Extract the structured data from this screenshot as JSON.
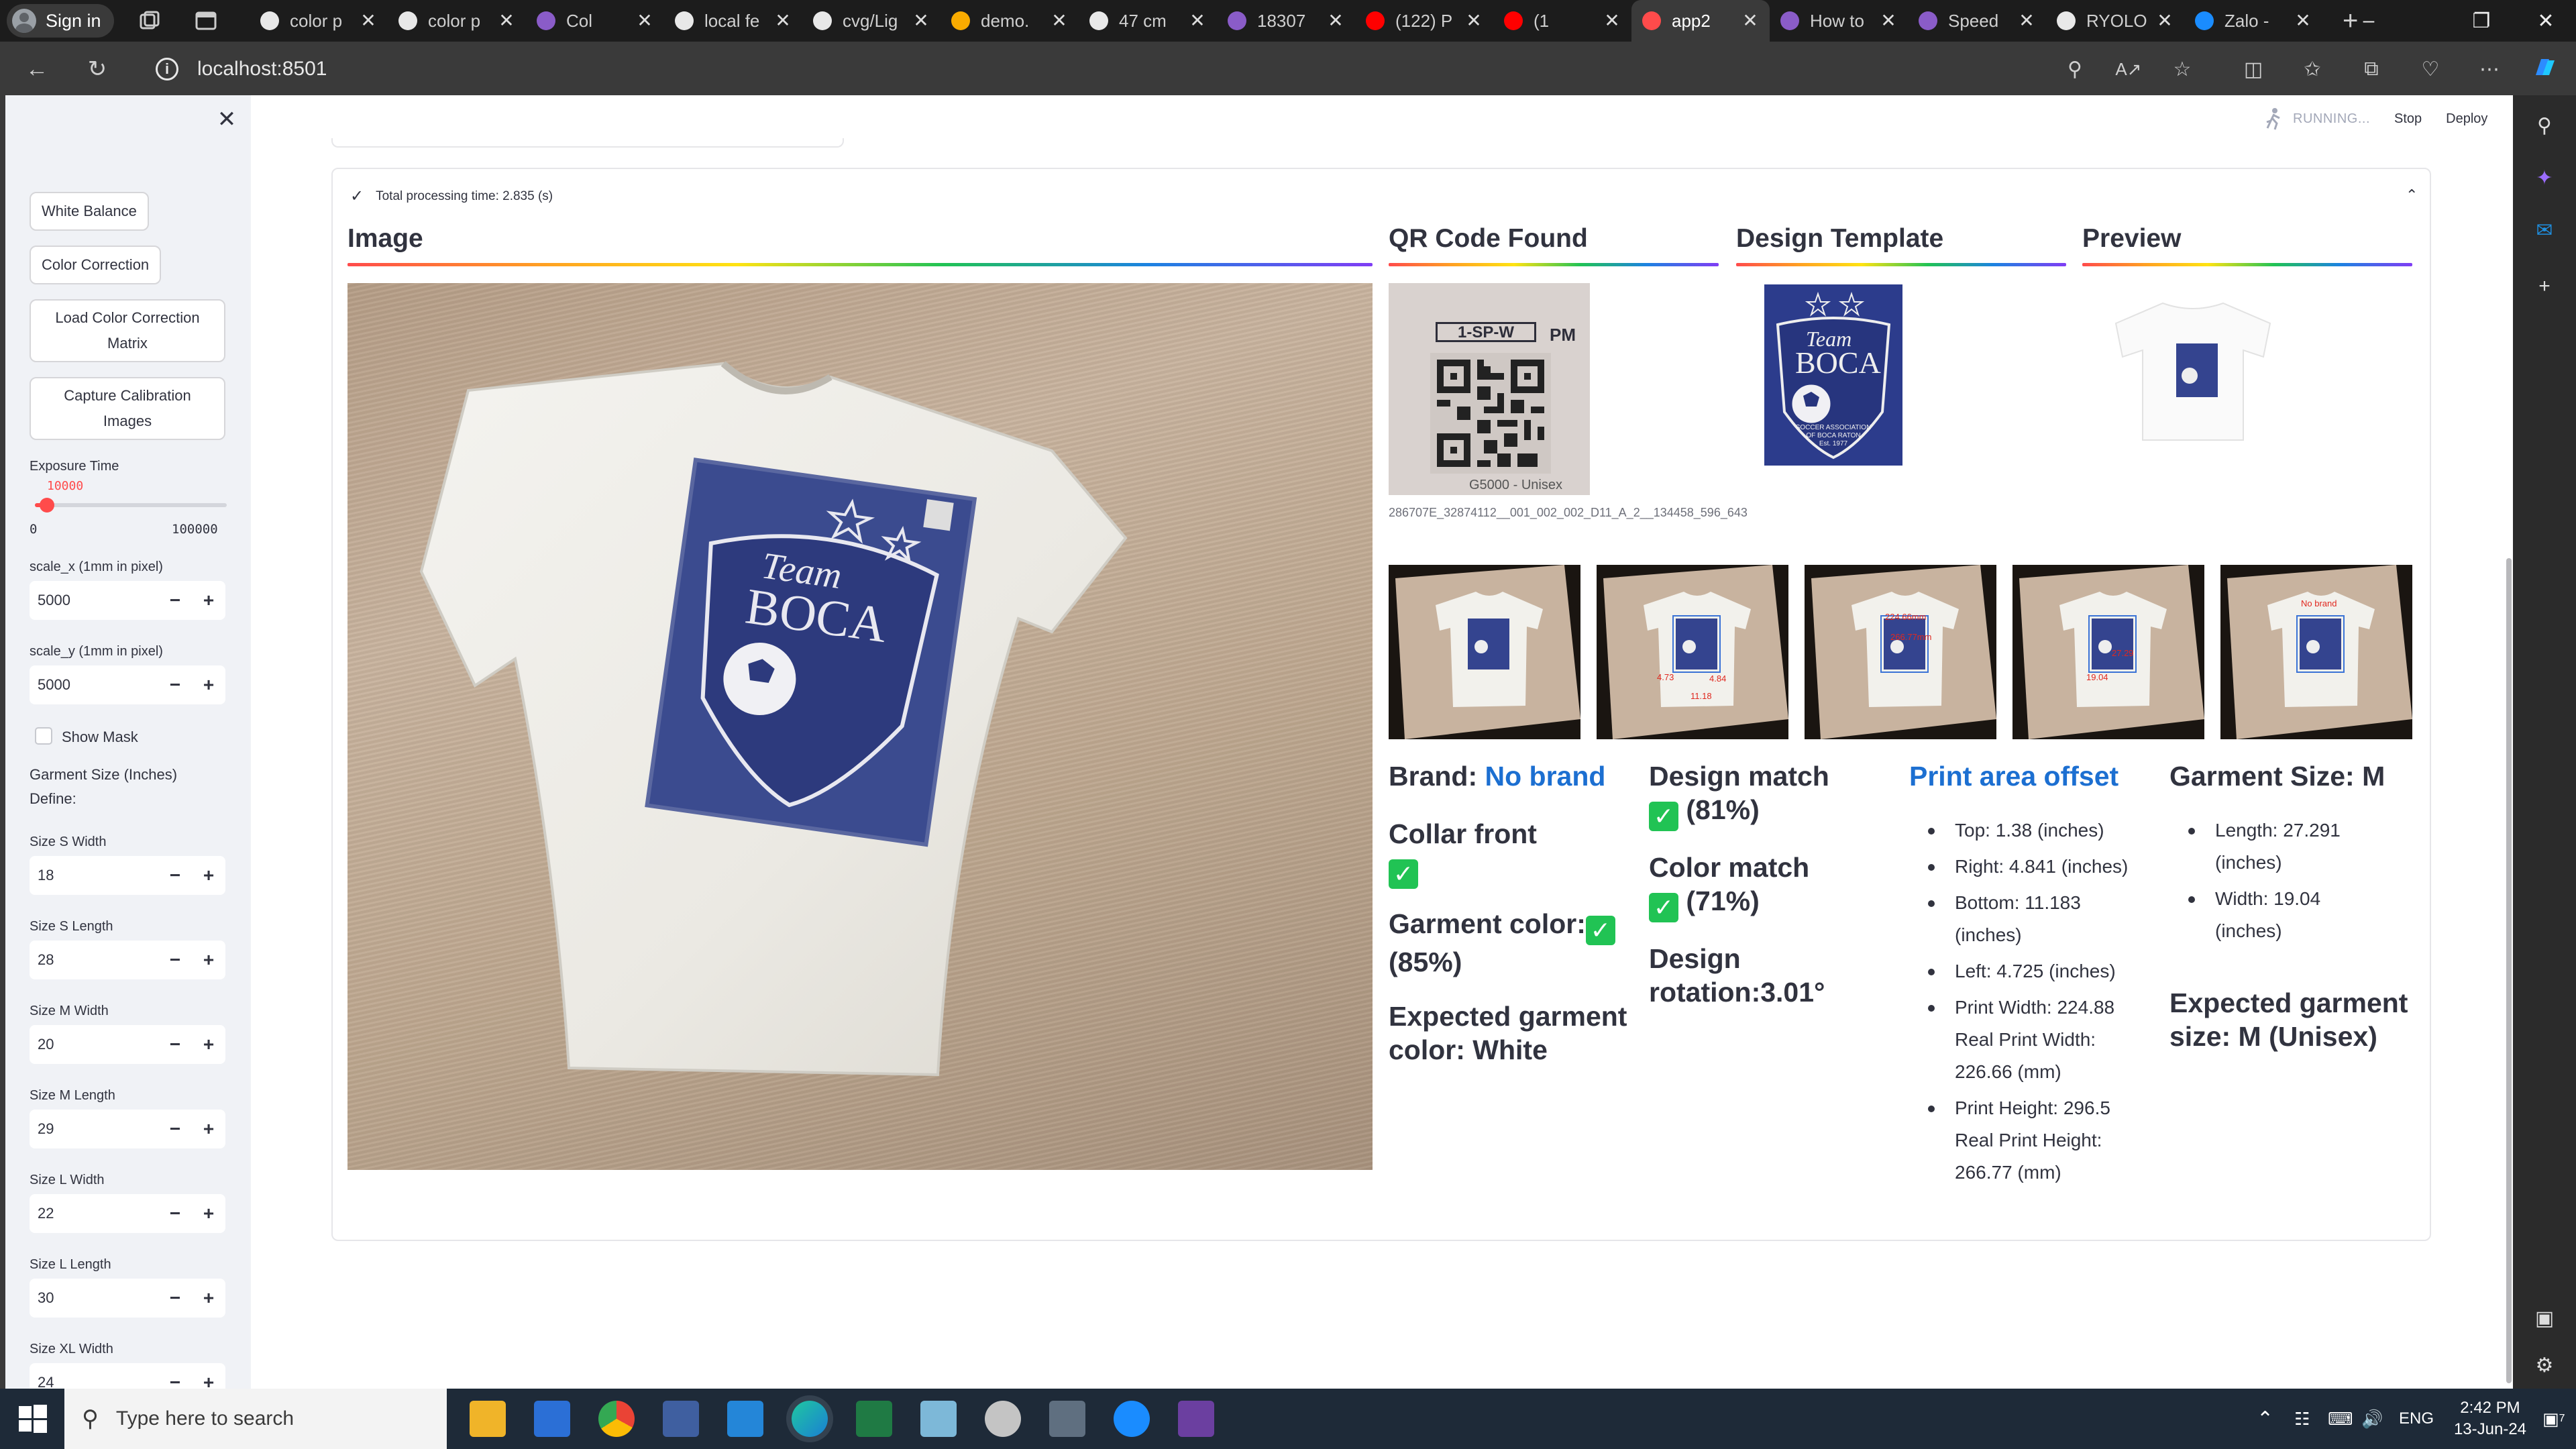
{
  "browser": {
    "profile_label": "Sign in",
    "tabs": [
      {
        "title": "color p",
        "icon": "google-icon"
      },
      {
        "title": "color p",
        "icon": "google-icon"
      },
      {
        "title": "Col",
        "icon": "app-icon"
      },
      {
        "title": "local fe",
        "icon": "google-icon"
      },
      {
        "title": "cvg/Lig",
        "icon": "github-icon"
      },
      {
        "title": "demo.",
        "icon": "colab-icon"
      },
      {
        "title": "47 cm",
        "icon": "google-icon"
      },
      {
        "title": "18307",
        "icon": "app-icon"
      },
      {
        "title": "(122) P",
        "icon": "youtube-icon"
      },
      {
        "title": "(1",
        "icon": "youtube-icon"
      },
      {
        "title": "app2",
        "icon": "streamlit-icon"
      },
      {
        "title": "How to",
        "icon": "app-icon"
      },
      {
        "title": "Speed",
        "icon": "app-icon"
      },
      {
        "title": "RYOLO",
        "icon": "github-icon"
      },
      {
        "title": "Zalo -",
        "icon": "zalo-icon"
      }
    ],
    "url": "localhost:8501"
  },
  "app_header": {
    "status": "RUNNING...",
    "stop_label": "Stop",
    "deploy_label": "Deploy"
  },
  "sidebar": {
    "buttons": {
      "white_balance": "White Balance",
      "color_correction": "Color Correction",
      "load_matrix": "Load Color Correction Matrix",
      "capture_calibration": "Capture Calibration Images"
    },
    "exposure": {
      "label": "Exposure Time",
      "value": "10000",
      "min": "0",
      "max": "100000",
      "fraction": 0.1
    },
    "scale_x": {
      "label": "scale_x (1mm in pixel)",
      "value": "5000"
    },
    "scale_y": {
      "label": "scale_y (1mm in pixel)",
      "value": "5000"
    },
    "show_mask": {
      "label": "Show Mask",
      "checked": false
    },
    "garment_size_heading": "Garment Size (Inches)",
    "define_label": "Define:",
    "sizes": [
      {
        "label": "Size S Width",
        "value": "18"
      },
      {
        "label": "Size S Length",
        "value": "28"
      },
      {
        "label": "Size M Width",
        "value": "20"
      },
      {
        "label": "Size M Length",
        "value": "29"
      },
      {
        "label": "Size L Width",
        "value": "22"
      },
      {
        "label": "Size L Length",
        "value": "30"
      },
      {
        "label": "Size XL Width",
        "value": "24"
      }
    ]
  },
  "results": {
    "processing_time": "Total processing time: 2.835 (s)",
    "image_heading": "Image",
    "qr_heading": "QR Code Found",
    "design_heading": "Design Template",
    "preview_heading": "Preview",
    "qr_caption": "286707E_32874112__001_002_002_D11_A_2__134458_596_643",
    "qr_label_top": "1-SP-W",
    "qr_label_pm": "PM",
    "qr_label_bottom": "G5000 - Unisex",
    "logo_team": "Team",
    "logo_boca": "BOCA",
    "logo_sub1": "SOCCER ASSOCIATION",
    "logo_sub2": "OF BOCA RATON",
    "logo_est": "Est. 1977",
    "tile_annotations": {
      "t2_a": "4.73",
      "t2_b": "4.84",
      "t2_c": "11.18",
      "t3_a": "224.66mm",
      "t3_b": "266.77mm",
      "t4_a": "27.29",
      "t4_b": "19.04",
      "t5_a": "No brand"
    },
    "brand_label": "Brand:",
    "brand_value": "No brand",
    "collar_label": "Collar front",
    "garment_color_label": "Garment color:",
    "garment_color_pct": "(85%)",
    "expected_color": "Expected garment color: White",
    "design_match_label": "Design match",
    "design_match_pct": "(81%)",
    "color_match_label": "Color match",
    "color_match_pct": "(71%)",
    "design_rotation": "Design rotation:3.01°",
    "print_offset_heading": "Print area offset",
    "print_offset": [
      "Top: 1.38 (inches)",
      "Right: 4.841 (inches)",
      "Bottom: 11.183 (inches)",
      "Left: 4.725 (inches)",
      "Print Width: 224.88 Real Print Width: 226.66 (mm)",
      "Print Height: 296.5 Real Print Height: 266.77 (mm)"
    ],
    "garment_size_heading": "Garment Size: M",
    "garment_size": [
      "Length: 27.291 (inches)",
      "Width: 19.04 (inches)"
    ],
    "expected_size": "Expected garment size: M (Unisex)"
  },
  "taskbar": {
    "search_placeholder": "Type here to search",
    "time": "2:42 PM",
    "date": "13-Jun-24",
    "lang": "ENG",
    "notif_count": "7"
  },
  "colors": {
    "accent": "#ff4b4b",
    "link_blue": "#1c6fd1",
    "success": "#21c354",
    "logo_navy": "#2c3c8c"
  }
}
